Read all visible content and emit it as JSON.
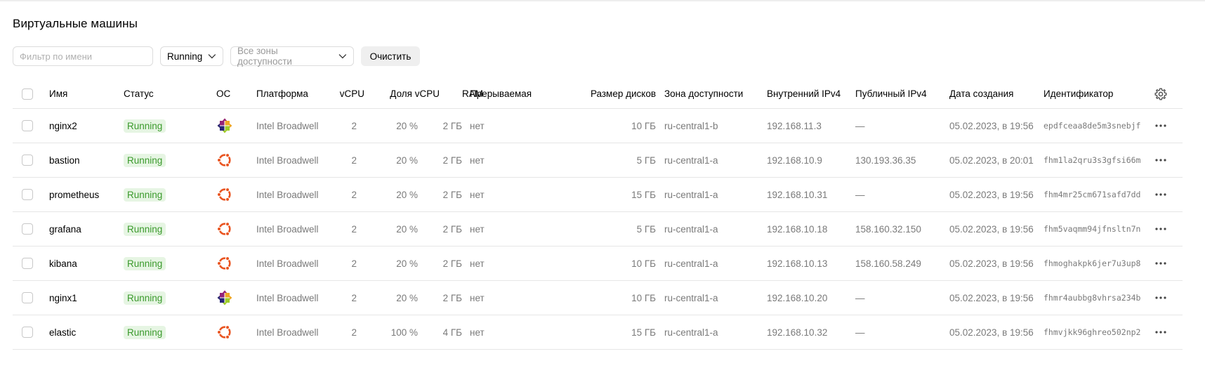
{
  "page": {
    "title": "Виртуальные машины"
  },
  "filters": {
    "name_placeholder": "Фильтр по имени",
    "status_value": "Running",
    "zone_value": "Все зоны доступности",
    "clear_label": "Очистить"
  },
  "table": {
    "headers": {
      "name": "Имя",
      "status": "Статус",
      "os": "ОС",
      "platform": "Платформа",
      "vcpu": "vCPU",
      "vcpu_share": "Доля vCPU",
      "ram": "RAM",
      "preemptible": "Прерываемая",
      "disk": "Размер дисков",
      "zone": "Зона доступности",
      "ipv4_internal": "Внутренний IPv4",
      "ipv4_public": "Публичный IPv4",
      "created": "Дата создания",
      "id": "Идентификатор"
    },
    "rows": [
      {
        "name": "nginx2",
        "status": "Running",
        "os": "centos-icon",
        "platform": "Intel Broadwell",
        "vcpu": "2",
        "vcpu_share": "20 %",
        "ram": "2 ГБ",
        "preemptible": "нет",
        "disk": "10 ГБ",
        "zone": "ru-central1-b",
        "ipv4_internal": "192.168.11.3",
        "ipv4_public": "—",
        "created": "05.02.2023, в 19:56",
        "id": "epdfceaa8de5m3snebjf"
      },
      {
        "name": "bastion",
        "status": "Running",
        "os": "ubuntu-icon",
        "platform": "Intel Broadwell",
        "vcpu": "2",
        "vcpu_share": "20 %",
        "ram": "2 ГБ",
        "preemptible": "нет",
        "disk": "5 ГБ",
        "zone": "ru-central1-a",
        "ipv4_internal": "192.168.10.9",
        "ipv4_public": "130.193.36.35",
        "created": "05.02.2023, в 20:01",
        "id": "fhm1la2qru3s3gfsi66m"
      },
      {
        "name": "prometheus",
        "status": "Running",
        "os": "ubuntu-icon",
        "platform": "Intel Broadwell",
        "vcpu": "2",
        "vcpu_share": "20 %",
        "ram": "2 ГБ",
        "preemptible": "нет",
        "disk": "15 ГБ",
        "zone": "ru-central1-a",
        "ipv4_internal": "192.168.10.31",
        "ipv4_public": "—",
        "created": "05.02.2023, в 19:56",
        "id": "fhm4mr25cm671safd7dd"
      },
      {
        "name": "grafana",
        "status": "Running",
        "os": "ubuntu-icon",
        "platform": "Intel Broadwell",
        "vcpu": "2",
        "vcpu_share": "20 %",
        "ram": "2 ГБ",
        "preemptible": "нет",
        "disk": "5 ГБ",
        "zone": "ru-central1-a",
        "ipv4_internal": "192.168.10.18",
        "ipv4_public": "158.160.32.150",
        "created": "05.02.2023, в 19:56",
        "id": "fhm5vaqmm94jfnsltn7n"
      },
      {
        "name": "kibana",
        "status": "Running",
        "os": "ubuntu-icon",
        "platform": "Intel Broadwell",
        "vcpu": "2",
        "vcpu_share": "20 %",
        "ram": "2 ГБ",
        "preemptible": "нет",
        "disk": "10 ГБ",
        "zone": "ru-central1-a",
        "ipv4_internal": "192.168.10.13",
        "ipv4_public": "158.160.58.249",
        "created": "05.02.2023, в 19:56",
        "id": "fhmoghakpk6jer7u3up8"
      },
      {
        "name": "nginx1",
        "status": "Running",
        "os": "centos-icon",
        "platform": "Intel Broadwell",
        "vcpu": "2",
        "vcpu_share": "20 %",
        "ram": "2 ГБ",
        "preemptible": "нет",
        "disk": "10 ГБ",
        "zone": "ru-central1-a",
        "ipv4_internal": "192.168.10.20",
        "ipv4_public": "—",
        "created": "05.02.2023, в 19:56",
        "id": "fhmr4aubbg8vhrsa234b"
      },
      {
        "name": "elastic",
        "status": "Running",
        "os": "ubuntu-icon",
        "platform": "Intel Broadwell",
        "vcpu": "2",
        "vcpu_share": "100 %",
        "ram": "4 ГБ",
        "preemptible": "нет",
        "disk": "15 ГБ",
        "zone": "ru-central1-a",
        "ipv4_internal": "192.168.10.32",
        "ipv4_public": "—",
        "created": "05.02.2023, в 19:56",
        "id": "fhmvjkk96ghreo502np2"
      }
    ]
  },
  "colors": {
    "status_running_bg": "#e6f5e3",
    "status_running_text": "#3b9a2c",
    "ubuntu_orange": "#e95420"
  }
}
